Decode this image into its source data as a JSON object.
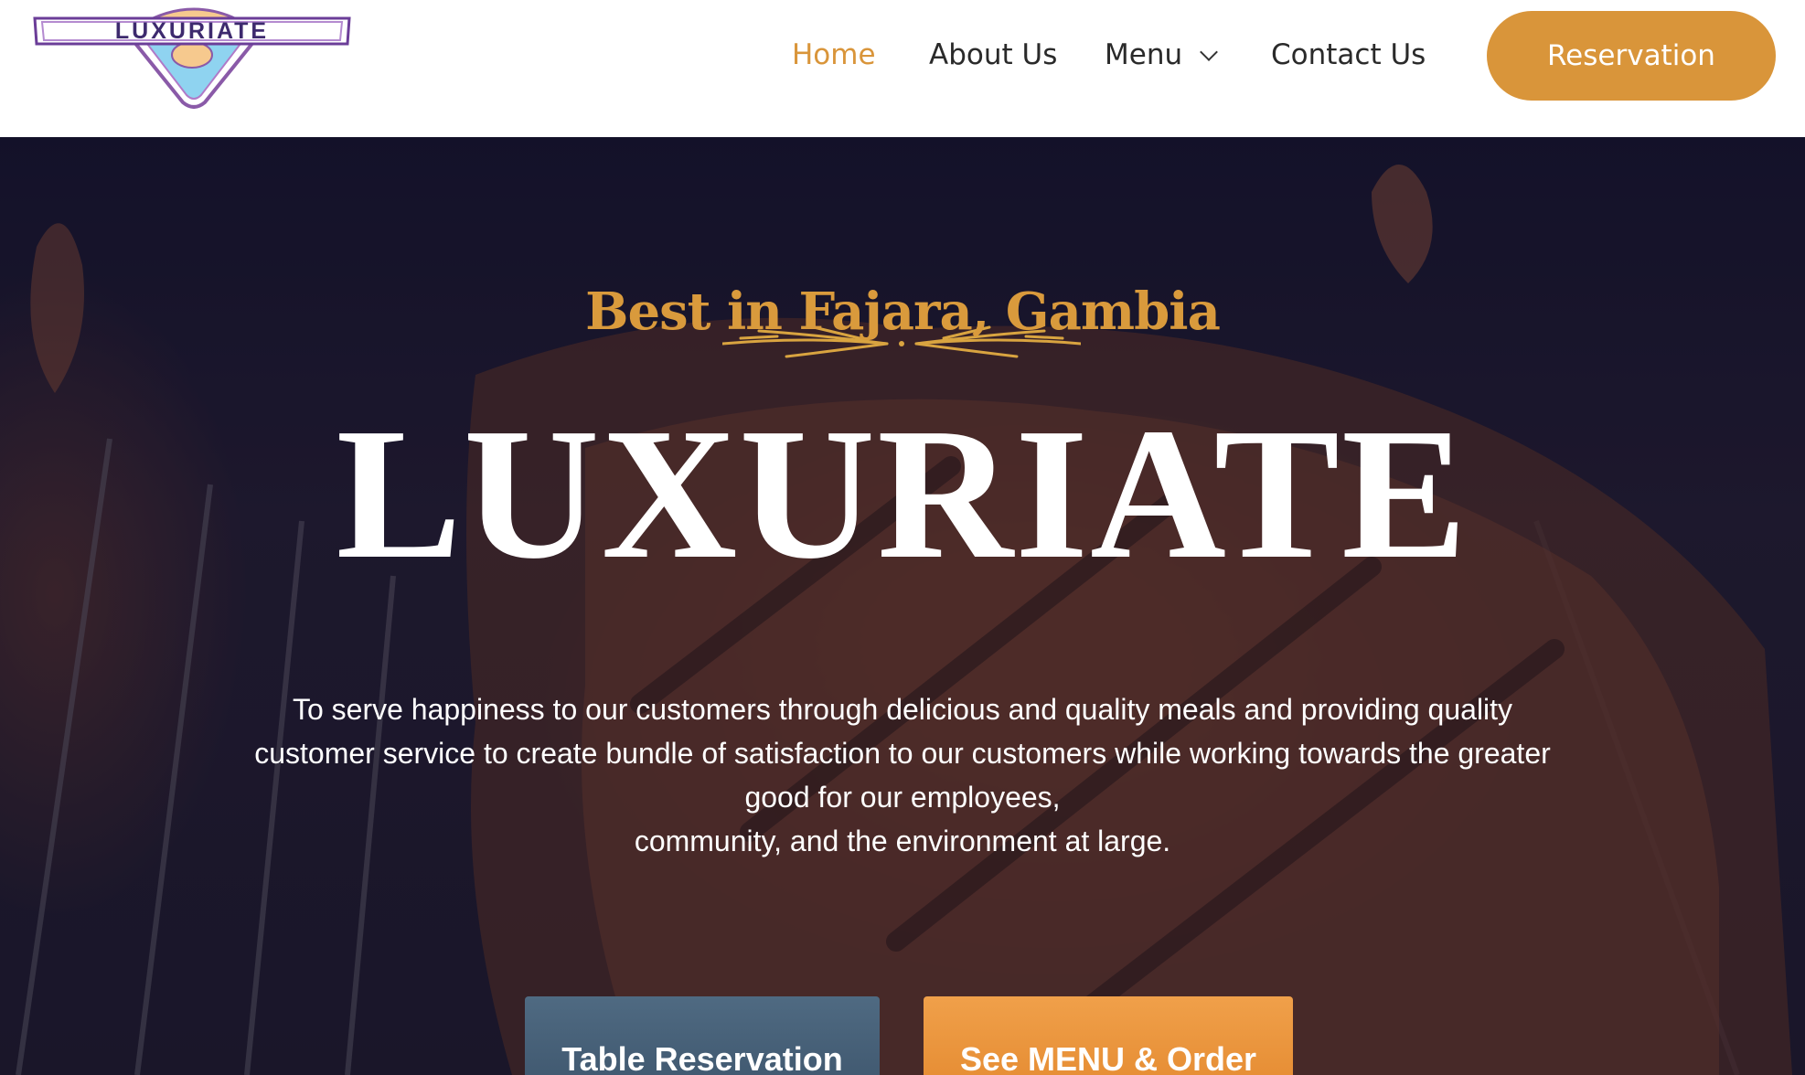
{
  "header": {
    "logo_text": "LUXURIATE",
    "nav": [
      {
        "label": "Home",
        "active": true
      },
      {
        "label": "About Us",
        "active": false
      },
      {
        "label": "Menu",
        "active": false,
        "has_dropdown": true
      },
      {
        "label": "Contact Us",
        "active": false
      }
    ],
    "reservation_label": "Reservation"
  },
  "hero": {
    "subtitle": "Best in Fajara, Gambia",
    "title": "LUXURIATE",
    "mission_lines": [
      "To serve happiness to our customers through delicious and quality meals and providing quality",
      "customer service to create bundle of satisfaction to our customers while working towards the greater",
      "good for our employees,",
      "community, and the environment at large."
    ],
    "buttons": {
      "table_reservation": "Table Reservation",
      "see_menu": "See MENU & Order"
    }
  },
  "colors": {
    "accent": "#d9953a",
    "nav_text": "#2a2a2a",
    "button_blue": "#4a6580",
    "button_orange": "#eb953c"
  }
}
